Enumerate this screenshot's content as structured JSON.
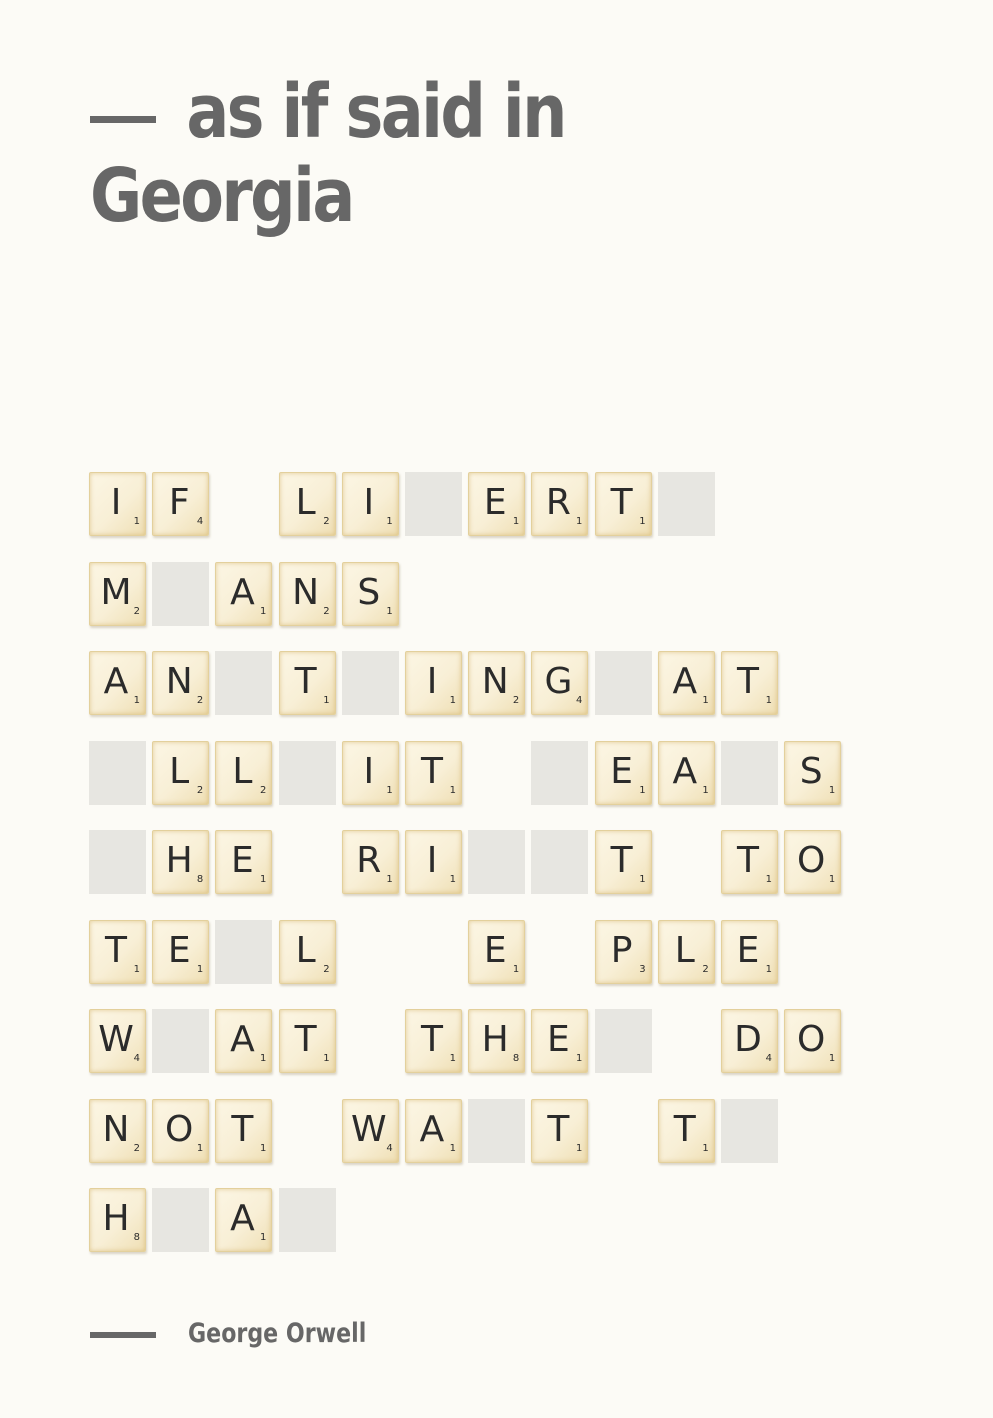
{
  "title": {
    "line1": "as if said in",
    "line2": "Georgia"
  },
  "author": "George Orwell",
  "colors": {
    "text": "#676767",
    "background": "#fcfbf6",
    "blank_tile": "#e7e6e1",
    "tile": "#f8efd6"
  },
  "rows": [
    [
      {
        "l": "I",
        "p": "1"
      },
      {
        "l": "F",
        "p": "4"
      },
      null,
      {
        "l": "L",
        "p": "2"
      },
      {
        "l": "I",
        "p": "1"
      },
      "_",
      {
        "l": "E",
        "p": "1"
      },
      {
        "l": "R",
        "p": "1"
      },
      {
        "l": "T",
        "p": "1"
      },
      "_"
    ],
    [
      {
        "l": "M",
        "p": "2"
      },
      "_",
      {
        "l": "A",
        "p": "1"
      },
      {
        "l": "N",
        "p": "2"
      },
      {
        "l": "S",
        "p": "1"
      }
    ],
    [
      {
        "l": "A",
        "p": "1"
      },
      {
        "l": "N",
        "p": "2"
      },
      "_",
      {
        "l": "T",
        "p": "1"
      },
      "_",
      {
        "l": "I",
        "p": "1"
      },
      {
        "l": "N",
        "p": "2"
      },
      {
        "l": "G",
        "p": "4"
      },
      "_",
      {
        "l": "A",
        "p": "1"
      },
      {
        "l": "T",
        "p": "1"
      }
    ],
    [
      "_",
      {
        "l": "L",
        "p": "2"
      },
      {
        "l": "L",
        "p": "2"
      },
      "_",
      {
        "l": "I",
        "p": "1"
      },
      {
        "l": "T",
        "p": "1"
      },
      null,
      "_",
      {
        "l": "E",
        "p": "1"
      },
      {
        "l": "A",
        "p": "1"
      },
      "_",
      {
        "l": "S",
        "p": "1"
      }
    ],
    [
      "_",
      {
        "l": "H",
        "p": "8"
      },
      {
        "l": "E",
        "p": "1"
      },
      null,
      {
        "l": "R",
        "p": "1"
      },
      {
        "l": "I",
        "p": "1"
      },
      "_",
      "_",
      {
        "l": "T",
        "p": "1"
      },
      null,
      {
        "l": "T",
        "p": "1"
      },
      {
        "l": "O",
        "p": "1"
      }
    ],
    [
      {
        "l": "T",
        "p": "1"
      },
      {
        "l": "E",
        "p": "1"
      },
      "_",
      {
        "l": "L",
        "p": "2"
      },
      null,
      null,
      {
        "l": "E",
        "p": "1"
      },
      null,
      {
        "l": "P",
        "p": "3"
      },
      {
        "l": "L",
        "p": "2"
      },
      {
        "l": "E",
        "p": "1"
      }
    ],
    [
      {
        "l": "W",
        "p": "4"
      },
      "_",
      {
        "l": "A",
        "p": "1"
      },
      {
        "l": "T",
        "p": "1"
      },
      null,
      {
        "l": "T",
        "p": "1"
      },
      {
        "l": "H",
        "p": "8"
      },
      {
        "l": "E",
        "p": "1"
      },
      "_",
      null,
      {
        "l": "D",
        "p": "4"
      },
      {
        "l": "O",
        "p": "1"
      }
    ],
    [
      {
        "l": "N",
        "p": "2"
      },
      {
        "l": "O",
        "p": "1"
      },
      {
        "l": "T",
        "p": "1"
      },
      null,
      {
        "l": "W",
        "p": "4"
      },
      {
        "l": "A",
        "p": "1"
      },
      "_",
      {
        "l": "T",
        "p": "1"
      },
      null,
      {
        "l": "T",
        "p": "1"
      },
      "_"
    ],
    [
      {
        "l": "H",
        "p": "8"
      },
      "_",
      {
        "l": "A",
        "p": "1"
      },
      "_"
    ]
  ]
}
